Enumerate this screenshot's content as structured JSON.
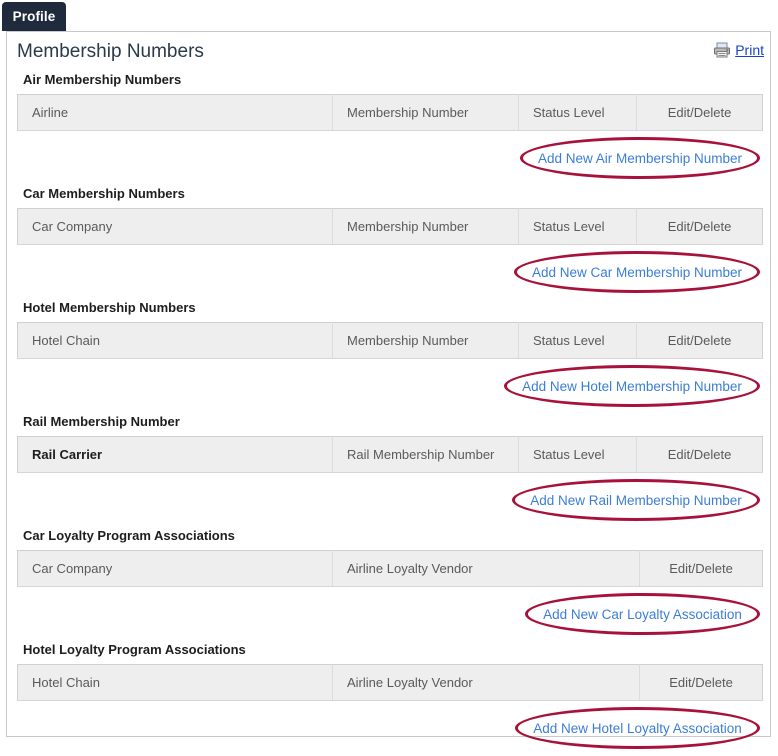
{
  "tab": {
    "label": "Profile"
  },
  "header": {
    "title": "Membership Numbers",
    "print_label": "Print",
    "print_icon": "printer-icon"
  },
  "colors": {
    "tab_background": "#1f2a3c",
    "annotation_ellipse": "#a8113a",
    "link_blue": "#3b7dd8",
    "print_link_blue": "#1a3fd0",
    "table_header_background": "#eeeeee",
    "panel_border": "#c9c9c9"
  },
  "sections": [
    {
      "label": "Air Membership Numbers",
      "columns": [
        "Airline",
        "Membership Number",
        "Status Level",
        "Edit/Delete"
      ],
      "first_column_strong": false,
      "layout": "c4",
      "add_link": "Add New Air Membership Number"
    },
    {
      "label": "Car Membership Numbers",
      "columns": [
        "Car Company",
        "Membership Number",
        "Status Level",
        "Edit/Delete"
      ],
      "first_column_strong": false,
      "layout": "c4",
      "add_link": "Add New Car Membership Number"
    },
    {
      "label": "Hotel Membership Numbers",
      "columns": [
        "Hotel Chain",
        "Membership Number",
        "Status Level",
        "Edit/Delete"
      ],
      "first_column_strong": false,
      "layout": "c4",
      "add_link": "Add New Hotel Membership Number"
    },
    {
      "label": "Rail Membership Number",
      "columns": [
        "Rail Carrier",
        "Rail Membership Number",
        "Status Level",
        "Edit/Delete"
      ],
      "first_column_strong": true,
      "layout": "c4",
      "add_link": "Add New Rail Membership Number"
    },
    {
      "label": "Car Loyalty Program Associations",
      "columns": [
        "Car Company",
        "Airline Loyalty Vendor",
        "Edit/Delete"
      ],
      "first_column_strong": false,
      "layout": "c3",
      "add_link": "Add New Car Loyalty Association"
    },
    {
      "label": "Hotel Loyalty Program Associations",
      "columns": [
        "Hotel Chain",
        "Airline Loyalty Vendor",
        "Edit/Delete"
      ],
      "first_column_strong": false,
      "layout": "c3",
      "add_link": "Add New Hotel Loyalty Association"
    }
  ]
}
